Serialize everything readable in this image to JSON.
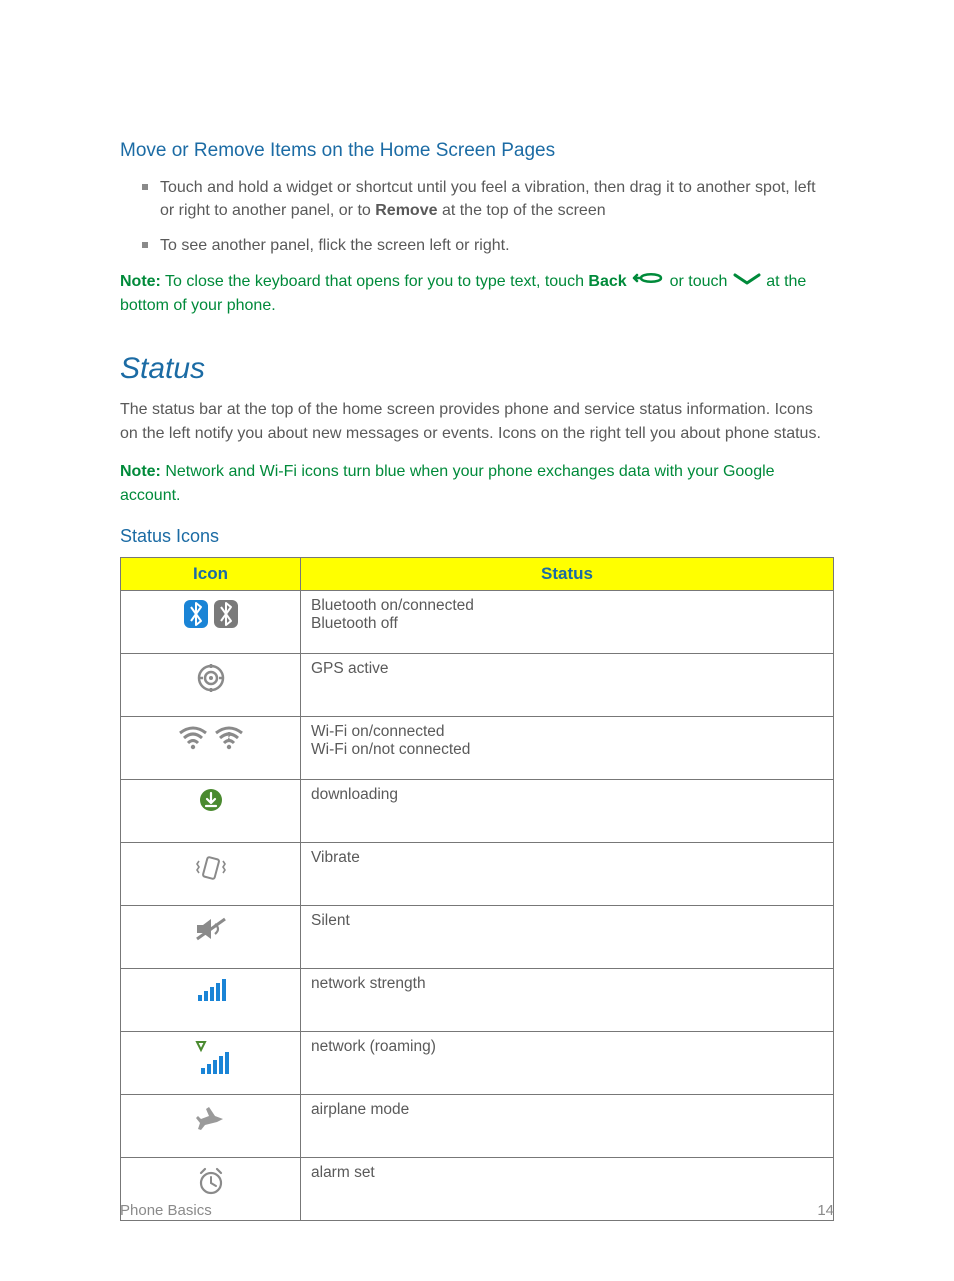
{
  "heading_move_remove": "Move or Remove Items on the Home Screen Pages",
  "bullets": {
    "b1_a": "Touch and hold a widget or shortcut until you feel a vibration, then drag it to another spot, left or right to another panel, or to ",
    "b1_bold": "Remove",
    "b1_b": " at the top of the screen",
    "b2": "To see another panel, flick the screen left or right."
  },
  "note1": {
    "label": "Note:",
    "t1": "  To close the keyboard that opens for you to type text, touch ",
    "bold": "Back",
    "t2": " or touch ",
    "t3": " at the bottom of your phone."
  },
  "status_title": "Status",
  "status_intro": "The status bar at the top of the home screen provides phone and service status information. Icons on the left notify you about new messages or events. Icons on the right tell you about phone status.",
  "note2": {
    "label": "Note:",
    "text": "  Network and Wi-Fi icons turn blue when your phone exchanges data with your Google account."
  },
  "status_icons_heading": "Status Icons",
  "table": {
    "h_icon": "Icon",
    "h_status": "Status",
    "rows": {
      "r1": "Bluetooth on/connected\nBluetooth off",
      "r2": "GPS active",
      "r3": "Wi-Fi on/connected\nWi-Fi on/not connected",
      "r4": "downloading",
      "r5": "Vibrate",
      "r6": "Silent",
      "r7": "network strength",
      "r8": "network (roaming)",
      "r9": "airplane mode",
      "r10": "alarm set"
    }
  },
  "footer": {
    "left": "Phone Basics",
    "right": "14"
  }
}
